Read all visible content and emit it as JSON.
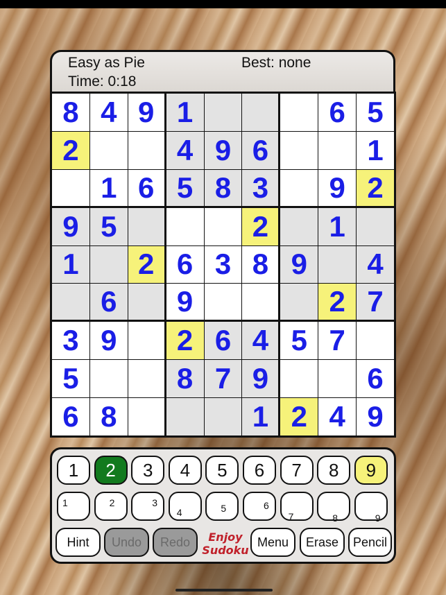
{
  "header": {
    "title": "Easy as Pie",
    "best": "Best: none",
    "time": "Time: 0:18"
  },
  "grid": [
    [
      "8",
      "4",
      "9",
      "1",
      "",
      "",
      "",
      "6",
      "5"
    ],
    [
      "2",
      "",
      "",
      "4",
      "9",
      "6",
      "",
      "",
      "1"
    ],
    [
      "",
      "1",
      "6",
      "5",
      "8",
      "3",
      "",
      "9",
      "2"
    ],
    [
      "9",
      "5",
      "",
      "",
      "",
      "2",
      "",
      "1",
      ""
    ],
    [
      "1",
      "",
      "2",
      "6",
      "3",
      "8",
      "9",
      "",
      "4"
    ],
    [
      "",
      "6",
      "",
      "9",
      "",
      "",
      "",
      "2",
      "7"
    ],
    [
      "3",
      "9",
      "",
      "2",
      "6",
      "4",
      "5",
      "7",
      ""
    ],
    [
      "5",
      "",
      "",
      "8",
      "7",
      "9",
      "",
      "",
      "6"
    ],
    [
      "6",
      "8",
      "",
      "",
      "",
      "1",
      "2",
      "4",
      "9"
    ]
  ],
  "highlighted_digit": "2",
  "number_buttons": [
    "1",
    "2",
    "3",
    "4",
    "5",
    "6",
    "7",
    "8",
    "9"
  ],
  "selected_number": "2",
  "highlighted_number_button": "9",
  "pencil_buttons": [
    "1",
    "2",
    "3",
    "4",
    "5",
    "6",
    "7",
    "8",
    "9"
  ],
  "actions": {
    "hint": "Hint",
    "undo": "Undo",
    "redo": "Redo",
    "enjoy_line1": "Enjoy",
    "enjoy_line2": "Sudoku",
    "menu": "Menu",
    "erase": "Erase",
    "pencil": "Pencil"
  },
  "colors": {
    "given_digit": "#1a1ee6",
    "highlight": "#f6f27a",
    "selected": "#127a1e",
    "disabled": "#9a9a9a",
    "shaded_box": "#e3e3e3"
  }
}
